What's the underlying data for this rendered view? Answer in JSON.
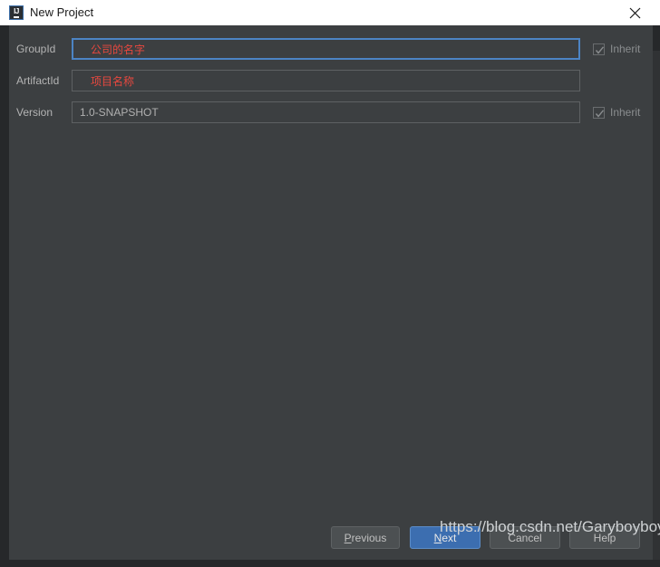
{
  "window": {
    "title": "New Project",
    "app_icon": "intellij-idea-icon",
    "app_icon_text": "IJ",
    "close_icon": "close-icon"
  },
  "form": {
    "rows": [
      {
        "label": "GroupId",
        "value": "公司的名字",
        "focused": true,
        "value_color": "#e8483f",
        "inherit": {
          "label": "Inherit",
          "checked": true
        }
      },
      {
        "label": "ArtifactId",
        "value": "项目名称",
        "focused": false,
        "value_color": "#e8483f",
        "inherit": null
      },
      {
        "label": "Version",
        "value": "1.0-SNAPSHOT",
        "focused": false,
        "value_color": "#b0b0b0",
        "inherit": {
          "label": "Inherit",
          "checked": true
        }
      }
    ]
  },
  "footer": {
    "previous": {
      "label": "Previous",
      "mnemonic": "P",
      "rest": "revious"
    },
    "next": {
      "label": "Next",
      "mnemonic": "N",
      "rest": "ext"
    },
    "cancel": {
      "label": "Cancel"
    },
    "help": {
      "label": "Help"
    }
  },
  "watermark": {
    "text": "https://blog.csdn.net/Garyboyboy"
  },
  "colors": {
    "dialog_bg": "#3c3f41",
    "window_border": "#26282a",
    "titlebar_bg": "#ffffff",
    "accent_blue": "#3c6eb0",
    "focus_border": "#4c84c4",
    "error_red": "#e8483f",
    "label_text": "#b4b4b4"
  }
}
